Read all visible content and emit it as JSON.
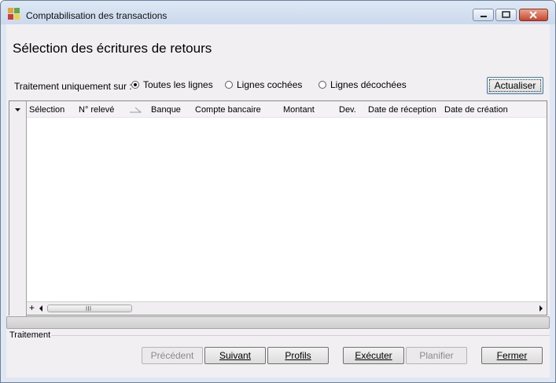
{
  "window": {
    "title": "Comptabilisation des transactions"
  },
  "page": {
    "heading": "Sélection des écritures de retours"
  },
  "filter": {
    "label": "Traitement uniquement sur :",
    "options": [
      {
        "label": "Toutes les lignes",
        "selected": true
      },
      {
        "label": "Lignes cochées",
        "selected": false
      },
      {
        "label": "Lignes décochées",
        "selected": false
      }
    ],
    "refresh_button": "Actualiser"
  },
  "grid": {
    "columns": [
      "Sélection",
      "N° relevé",
      "Banque",
      "Compte bancaire",
      "Montant",
      "Dev.",
      "Date de réception",
      "Date de création"
    ],
    "rows": []
  },
  "footer": {
    "group_label": "Traitement",
    "buttons": {
      "previous": "Précédent",
      "next": "Suivant",
      "profiles": "Profils",
      "execute": "Exécuter",
      "schedule": "Planifier",
      "close": "Fermer"
    }
  },
  "colors": {
    "title_gradient_top": "#dde8f5",
    "client_bg": "#f2eff3",
    "close_button": "#c5452f"
  }
}
